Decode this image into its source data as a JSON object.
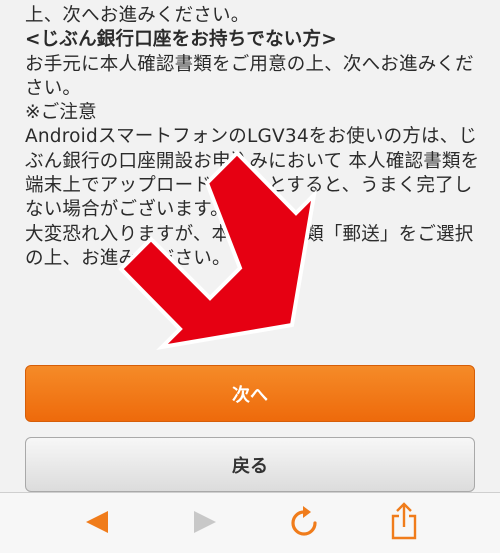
{
  "content": {
    "lines": [
      "上、次へお進みください。",
      "<じぶん銀行口座をお持ちでない方>",
      "お手元に本人確認書類をご用意の上、次へお進みくだ",
      "さい。",
      "※ご注意",
      "AndroidスマートフォンのLGV34をお使いの方は、じ",
      "ぶん銀行の口座開設お申込みにおいて 本人確認書類を",
      "端末上でアップロードしようとすると、うまく完了し",
      "ない場合がございます。",
      "大変恐れ入りますが、本人確認書類「郵送」をご選択",
      "の上、お進みください。"
    ]
  },
  "buttons": {
    "next_label": "次へ",
    "back_label": "戻る"
  },
  "colors": {
    "accent": "#ee6a0b",
    "arrow": "#e60012",
    "toolbar_icon_active": "#f07c1b",
    "toolbar_icon_disabled": "#c8c8c8"
  },
  "toolbar": {
    "icons": [
      "back-arrow-icon",
      "forward-arrow-icon",
      "reload-icon",
      "share-icon"
    ]
  }
}
